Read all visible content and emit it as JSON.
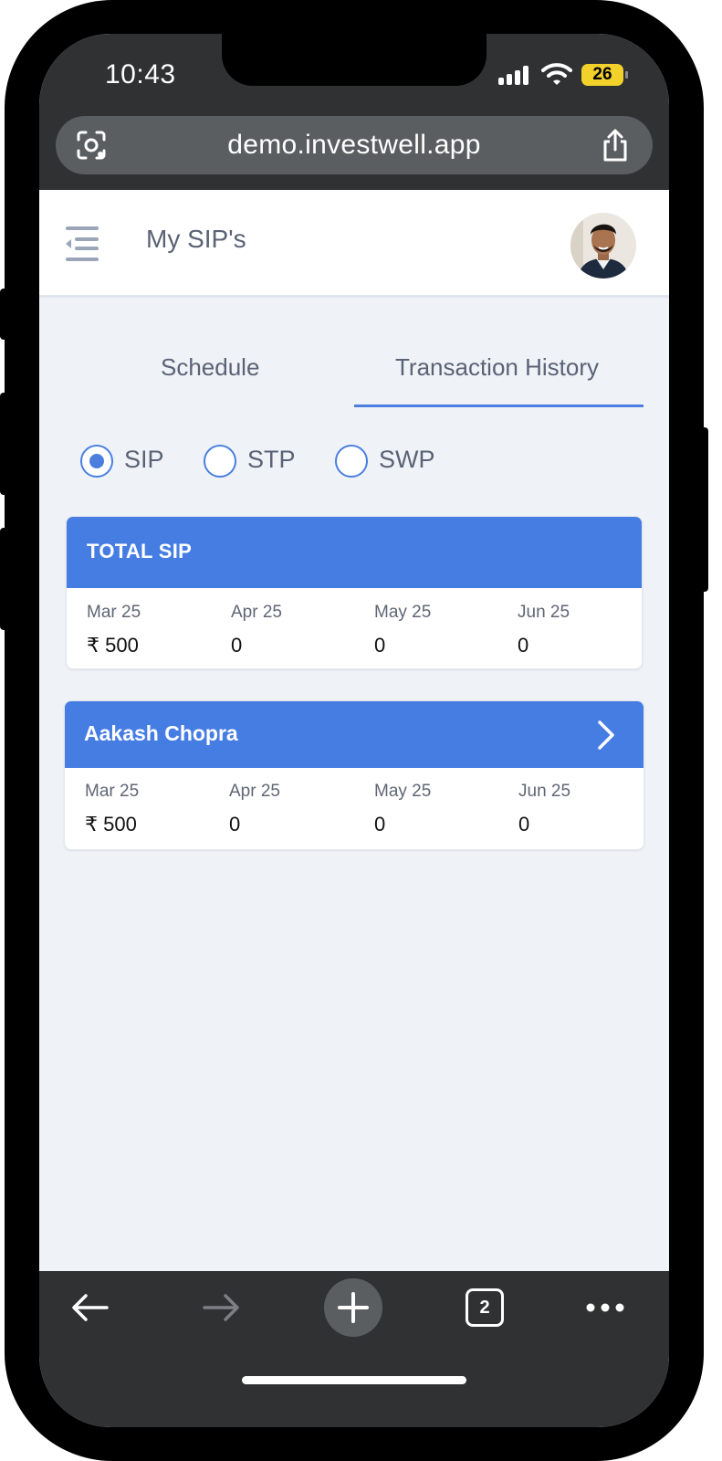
{
  "status_bar": {
    "time": "10:43",
    "battery": "26"
  },
  "browser": {
    "url": "demo.investwell.app",
    "tab_count": "2"
  },
  "header": {
    "title": "My SIP's"
  },
  "tabs": [
    {
      "label": "Schedule",
      "active": false
    },
    {
      "label": "Transaction History",
      "active": true
    }
  ],
  "plan_types": [
    {
      "label": "SIP",
      "selected": true
    },
    {
      "label": "STP",
      "selected": false
    },
    {
      "label": "SWP",
      "selected": false
    }
  ],
  "total_card": {
    "title": "TOTAL SIP",
    "months": [
      {
        "month": "Mar 25",
        "value": "₹ 500"
      },
      {
        "month": "Apr 25",
        "value": "0"
      },
      {
        "month": "May 25",
        "value": "0"
      },
      {
        "month": "Jun 25",
        "value": "0"
      }
    ]
  },
  "investor_card": {
    "name": "Aakash Chopra",
    "months": [
      {
        "month": "Mar 25",
        "value": "₹ 500"
      },
      {
        "month": "Apr 25",
        "value": "0"
      },
      {
        "month": "May 25",
        "value": "0"
      },
      {
        "month": "Jun 25",
        "value": "0"
      }
    ]
  },
  "colors": {
    "accent": "#467de3",
    "background": "#eff3f8",
    "chrome": "#2f3133"
  }
}
